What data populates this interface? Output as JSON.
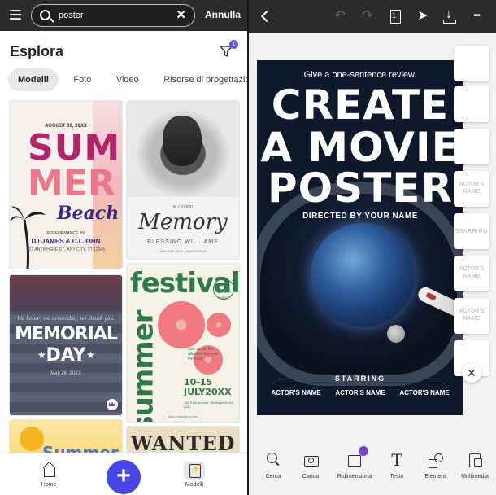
{
  "left": {
    "search": {
      "value": "poster",
      "clear_symbol": "✕"
    },
    "cancel_label": "Annulla",
    "section_title": "Esplora",
    "filter_badge": "1",
    "tabs": [
      {
        "label": "Modelli",
        "active": true
      },
      {
        "label": "Foto",
        "active": false
      },
      {
        "label": "Video",
        "active": false
      },
      {
        "label": "Risorse di progettazione",
        "active": false
      }
    ],
    "templates": {
      "summer": {
        "date": "AUGUST 30, 20XX",
        "line1": "SUM",
        "line2": "MER",
        "line3": "Beach",
        "performance": "PERFORMANCE BY",
        "djs": "DJ JAMES & DJ JOHN",
        "address": "123 ANYWHERE ST., ANY CITY, ST 12345"
      },
      "memory": {
        "in_loving": "IN LOVING",
        "title": "Memory",
        "name": "BLESSING WILLIAMS",
        "dates": "JANUARY 20XX - MARCH 20XX"
      },
      "memorial": {
        "tagline": "We honor, we remember, we thank you.",
        "line1": "MEMORIAL",
        "line2": "DAY",
        "date": "May 26, 20XX"
      },
      "festival": {
        "line1": "festival",
        "line2": "summer",
        "badge": "MID SUMMER EVENT",
        "join": "Join us for the ultimate Summer Festival!",
        "dates": "10-15 JULY20XX",
        "address": "746 Park Avenue, Birmingham, B1 2AQ",
        "footer": "REALLYGREATSITE.COM"
      },
      "summer2": {
        "title": "Summer"
      },
      "wanted": {
        "title": "WANTED"
      }
    },
    "bottom_nav": [
      {
        "label": "Home"
      },
      {
        "label": "Modelli"
      }
    ],
    "fab_symbol": "+"
  },
  "right": {
    "poster": {
      "review": "Give a one-sentence review.",
      "line1": "CREATE",
      "line2": "A MOVIE",
      "line3": "POSTER",
      "directed": "DIRECTED BY YOUR NAME",
      "starring": "STARRING",
      "actors": [
        "ACTOR'S NAME",
        "ACTOR'S NAME",
        "ACTOR'S NAME"
      ]
    },
    "thumbnails": [
      {
        "label": ""
      },
      {
        "label": ""
      },
      {
        "label": ""
      },
      {
        "label": "ACTOR'S NAME"
      },
      {
        "label": "STARRING"
      },
      {
        "label": "ACTOR'S NAME"
      },
      {
        "label": "ACTOR'S NAME"
      },
      {
        "label": ""
      }
    ],
    "close_symbol": "✕",
    "tools": [
      {
        "label": "Cerca"
      },
      {
        "label": "Carica"
      },
      {
        "label": "Ridimensiona"
      },
      {
        "label": "Testo"
      },
      {
        "label": "Elementi"
      },
      {
        "label": "Multimedia"
      }
    ],
    "text_tool_glyph": "T",
    "more_symbol": "•••"
  },
  "colors": {
    "accent": "#4646e6",
    "premium": "#7b3fd0",
    "topbar": "#2c2c2c"
  }
}
